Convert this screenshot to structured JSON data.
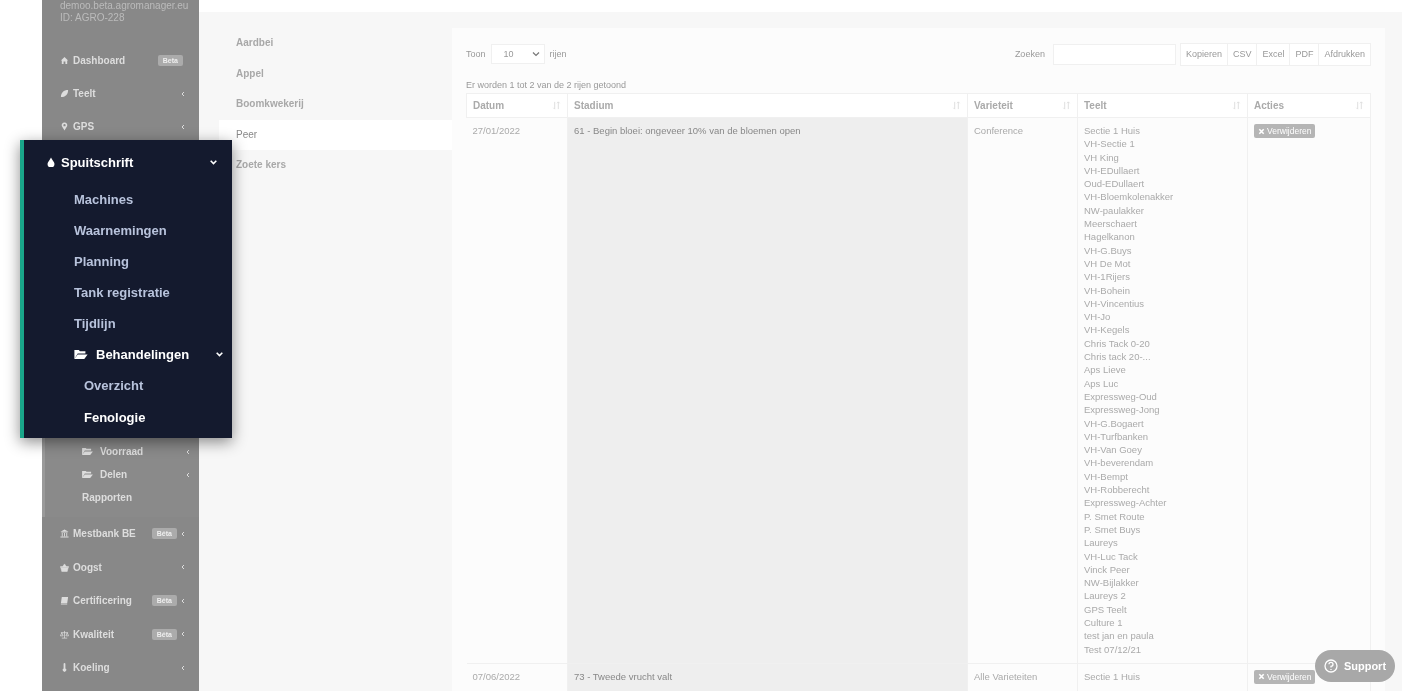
{
  "sidebar": {
    "domain": "demoo.beta.agromanager.eu",
    "account_id": "ID: AGRO-228",
    "top_items": [
      {
        "label": "Dashboard",
        "kind": "link",
        "badge": "Beta"
      },
      {
        "label": "Teelt",
        "kind": "group",
        "expanded": false
      },
      {
        "label": "GPS",
        "kind": "group",
        "expanded": false
      }
    ],
    "sub_items": [
      {
        "label": "Voorraad",
        "kind": "group",
        "expanded": false
      },
      {
        "label": "Delen",
        "kind": "group",
        "expanded": false
      },
      {
        "label": "Rapporten",
        "kind": "link"
      }
    ],
    "bottom_items": [
      {
        "label": "Mestbank BE",
        "kind": "group",
        "expanded": false,
        "badge": "Béta"
      },
      {
        "label": "Oogst",
        "kind": "group",
        "expanded": false
      },
      {
        "label": "Certificering",
        "kind": "group",
        "expanded": false,
        "badge": "Béta"
      },
      {
        "label": "Kwaliteit",
        "kind": "group",
        "expanded": false,
        "badge": "Béta"
      },
      {
        "label": "Koeling",
        "kind": "group",
        "expanded": false
      }
    ]
  },
  "popup_menu": {
    "title": "Spuitschrift",
    "expanded": true,
    "items": [
      {
        "label": "Machines",
        "kind": "link",
        "selected": false
      },
      {
        "label": "Waarnemingen",
        "kind": "link",
        "selected": false
      },
      {
        "label": "Planning",
        "kind": "link",
        "selected": false
      },
      {
        "label": "Tank registratie",
        "kind": "link",
        "selected": false
      },
      {
        "label": "Tijdlijn",
        "kind": "link",
        "selected": false
      },
      {
        "label": "Behandelingen",
        "kind": "group",
        "expanded": true,
        "children": [
          {
            "label": "Overzicht",
            "selected": false
          },
          {
            "label": "Fenologie",
            "selected": true
          }
        ]
      }
    ]
  },
  "crop_tabs": [
    {
      "label": "Aardbei",
      "selected": false
    },
    {
      "label": "Appel",
      "selected": false
    },
    {
      "label": "Boomkwekerij",
      "selected": false
    },
    {
      "label": "Peer",
      "selected": true
    },
    {
      "label": "Zoete kers",
      "selected": false
    }
  ],
  "table": {
    "length_prefix": "Toon",
    "length_value": "10",
    "length_suffix": "rijen",
    "search_label": "Zoeken",
    "export_buttons": [
      "Kopieren",
      "CSV",
      "Excel",
      "PDF",
      "Afdrukken"
    ],
    "info": "Er worden 1 tot 2 van de 2 rijen getoond",
    "columns": [
      "Datum",
      "Stadium",
      "Varieteit",
      "Teelt",
      "Acties"
    ],
    "rows": [
      {
        "date": "27/01/2022",
        "stage": "61 - Begin bloei: ongeveer 10% van de bloemen open",
        "variety": "Conference",
        "action": "Verwijderen",
        "fields": [
          "Sectie 1 Huis",
          "VH-Sectie 1",
          "VH King",
          "VH-EDullaert",
          "Oud-EDullaert",
          "VH-Bloemkolenakker",
          "NW-paulakker",
          "Meerschaert",
          "Hagelkanon",
          "VH-G.Buys",
          "VH De Mot",
          "VH-1Rijers",
          "VH-Bohein",
          "VH-Vincentius",
          "VH-Jo",
          "VH-Kegels",
          "Chris Tack 0-20",
          "Chris tack 20-...",
          "Aps Lieve",
          "Aps Luc",
          "Expressweg-Oud",
          "Expressweg-Jong",
          "VH-G.Bogaert",
          "VH-Turfbanken",
          "VH-Van Goey",
          "VH-beverendam",
          "VH-Bempt",
          "VH-Robberecht",
          "Expressweg-Achter",
          "P. Smet Route",
          "P. Smet Buys",
          "Laureys",
          "VH-Luc Tack",
          "Vinck Peer",
          "NW-Bijlakker",
          "Laureys 2",
          "GPS Teelt",
          "Culture 1",
          "test jan en paula",
          "Test 07/12/21"
        ]
      },
      {
        "date": "07/06/2022",
        "stage": "73 - Tweede vrucht valt",
        "variety": "Alle Varieteiten",
        "action": "Verwijderen",
        "fields": [
          "Sectie 1 Huis"
        ]
      }
    ]
  },
  "support_button": "Support"
}
